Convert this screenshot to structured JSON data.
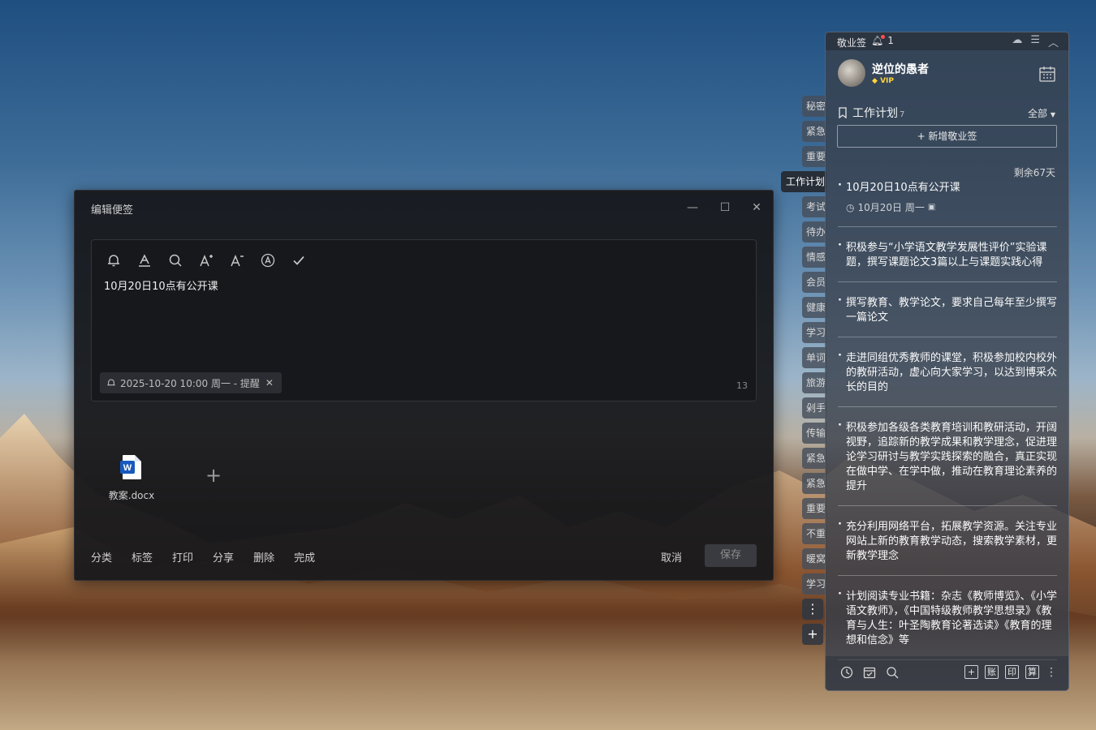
{
  "editor": {
    "title": "编辑便签",
    "content": "10月20日10点有公开课",
    "reminder": "2025-10-20 10:00 周一 - 提醒",
    "char_count": "13",
    "attachment_name": "教案.docx",
    "footer": [
      "分类",
      "标签",
      "打印",
      "分享",
      "删除",
      "完成"
    ],
    "cancel_label": "取消",
    "save_label": "保存"
  },
  "tabs": [
    "秘密",
    "紧急",
    "重要",
    "工作计划",
    "考试",
    "待办",
    "情感",
    "会员",
    "健康",
    "学习",
    "单词",
    "旅游",
    "剁手",
    "传输",
    "紧急",
    "紧急",
    "重要",
    "不重",
    "暖窝",
    "学习"
  ],
  "tab_more": "⋮",
  "tab_add": "+",
  "panel": {
    "app_name": "敬业签",
    "notify_count": "1",
    "user_name": "逆位的愚者",
    "vip": "VIP",
    "category": "工作计划",
    "category_count": "7",
    "filter_label": "全部",
    "new_label": "+ 新增敬业签",
    "remaining": "剩余67天",
    "notes": [
      {
        "text": "10月20日10点有公开课",
        "meta": "10月20日 周一"
      },
      {
        "text": "积极参与“小学语文教学发展性评价”实验课题，撰写课题论文3篇以上与课题实践心得"
      },
      {
        "text": "撰写教育、教学论文，要求自己每年至少撰写一篇论文"
      },
      {
        "text": "走进同组优秀教师的课堂，积极参加校内校外的教研活动，虚心向大家学习，以达到博采众长的目的"
      },
      {
        "text": "积极参加各级各类教育培训和教研活动，开阔视野，追踪新的教学成果和教学理念，促进理论学习研讨与教学实践探索的融合，真正实现在做中学、在学中做，推动在教育理论素养的提升"
      },
      {
        "text": "充分利用网络平台，拓展教学资源。关注专业网站上新的教育教学动态，搜索教学素材，更新教学理念"
      },
      {
        "text": "计划阅读专业书籍：杂志《教师博览》、《小学语文教师》，《中国特级教师教学思想录》《教育与人生：叶圣陶教育论著选读》《教育的理想和信念》等"
      }
    ],
    "footer_right": [
      "账",
      "印",
      "算"
    ]
  }
}
